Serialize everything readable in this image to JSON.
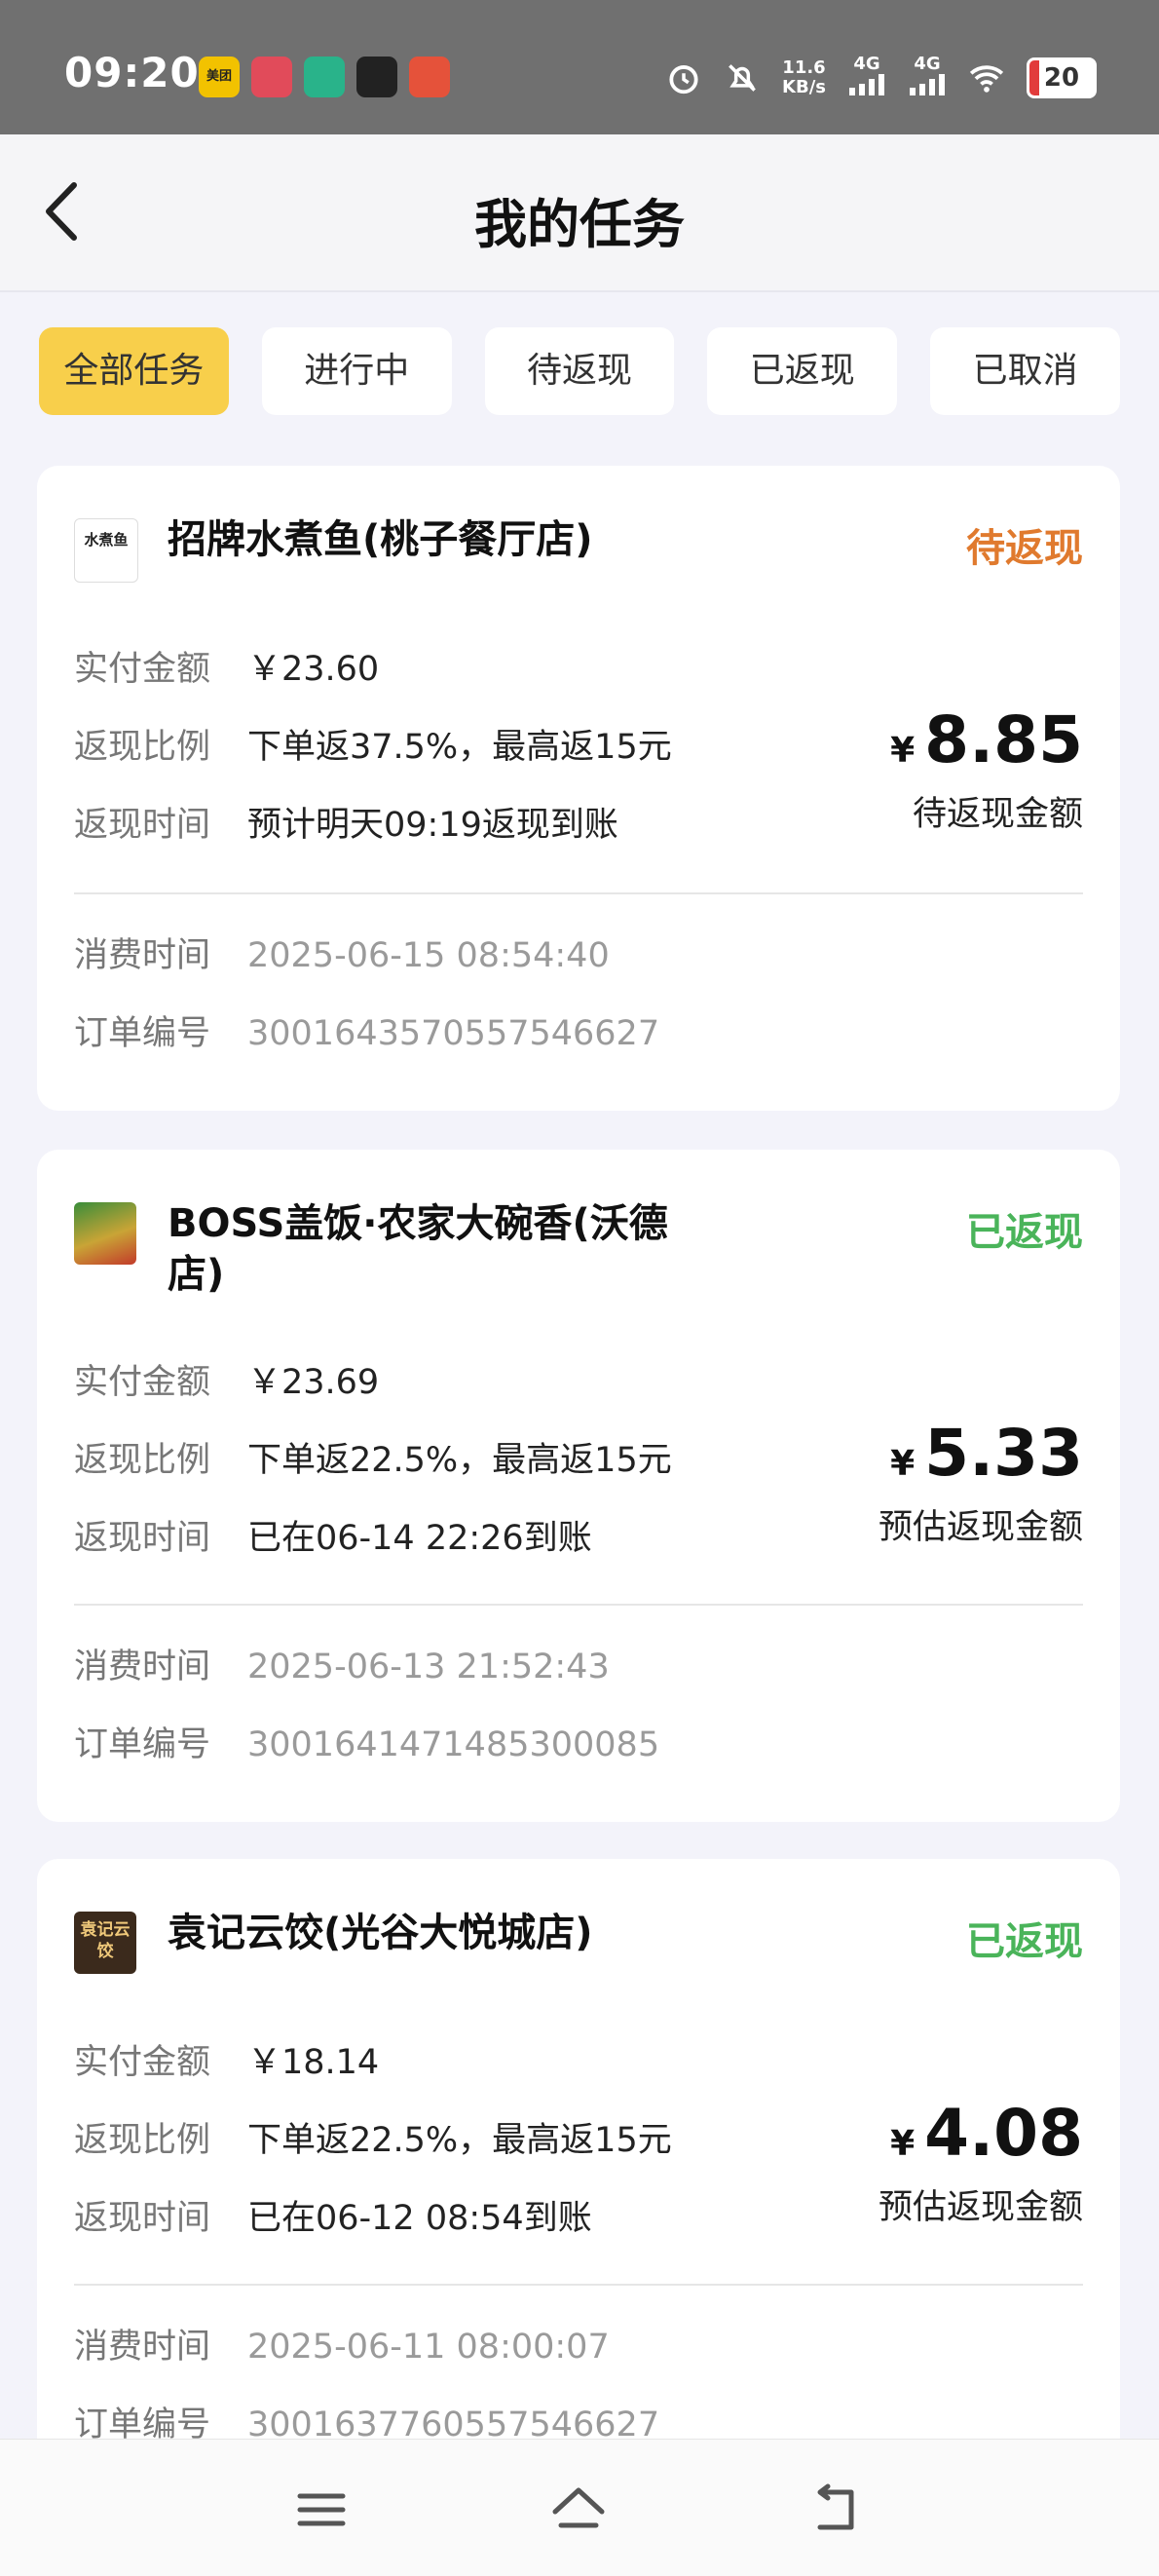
{
  "status_bar": {
    "time": "09:20",
    "app_icons": [
      {
        "name": "meituan-app-icon",
        "text": "美团",
        "color": "#f2c200"
      },
      {
        "name": "app-icon-2",
        "text": "",
        "color": "#e14b5a"
      },
      {
        "name": "video-app-icon",
        "text": "",
        "color": "#29b38a"
      },
      {
        "name": "qq-icon",
        "text": "",
        "color": "#222222"
      },
      {
        "name": "app-icon-5",
        "text": "",
        "color": "#e5523a"
      }
    ],
    "net_speed": "11.6",
    "net_unit": "KB/s",
    "sig1": "4G",
    "sig2": "4G",
    "battery": "20"
  },
  "header": {
    "title": "我的任务"
  },
  "tabs": [
    "全部任务",
    "进行中",
    "待返现",
    "已返现",
    "已取消"
  ],
  "tab_active": "全部任务",
  "labels": {
    "paid": "实付金额",
    "ratio": "返现比例",
    "time": "返现时间",
    "consume_time": "消费时间",
    "order_no": "订单编号"
  },
  "orders": [
    {
      "shop": "招牌水煮鱼(桃子餐厅店)",
      "status": "待返现",
      "paid": "￥23.60",
      "ratio": "下单返37.5%，最高返15元",
      "cashback_time": "预计明天09:19返现到账",
      "currency": "¥",
      "amount": "8.85",
      "amount_label": "待返现金额",
      "consume_time": "2025-06-15 08:54:40",
      "order_no": "3001643570557546627"
    },
    {
      "shop": "BOSS盖饭·农家大碗香(沃德店)",
      "status": "已返现",
      "paid": "￥23.69",
      "ratio": "下单返22.5%，最高返15元",
      "cashback_time": "已在06-14 22:26到账",
      "currency": "¥",
      "amount": "5.33",
      "amount_label": "预估返现金额",
      "consume_time": "2025-06-13 21:52:43",
      "order_no": "3001641471485300085"
    },
    {
      "shop": "袁记云饺(光谷大悦城店)",
      "status": "已返现",
      "paid": "￥18.14",
      "ratio": "下单返22.5%，最高返15元",
      "cashback_time": "已在06-12 08:54到账",
      "currency": "¥",
      "amount": "4.08",
      "amount_label": "预估返现金额",
      "consume_time": "2025-06-11 08:00:07",
      "order_no": "3001637760557546627"
    }
  ],
  "logo_texts": [
    "水煮鱼",
    "",
    "袁记云饺"
  ],
  "colors": {
    "accent_yellow": "#f8cf4b",
    "pending_orange": "#e07a2e",
    "done_green": "#4ab45a"
  }
}
